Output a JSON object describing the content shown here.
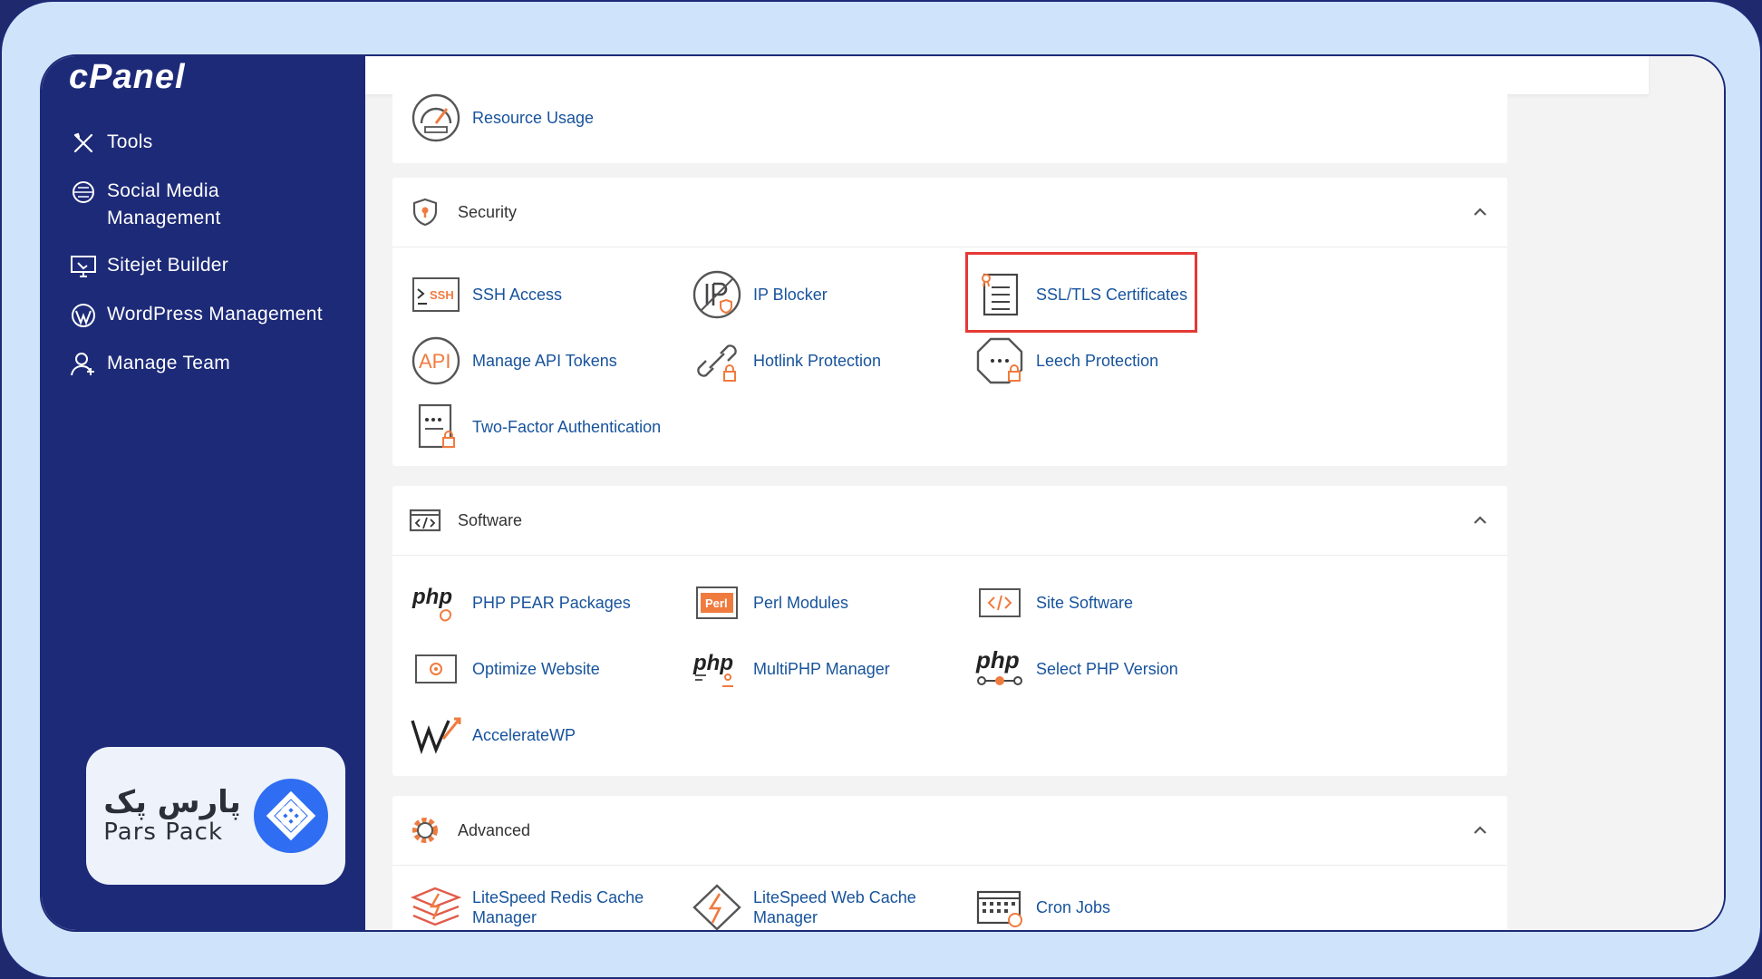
{
  "sidebar": {
    "logo": "cPanel",
    "items": [
      {
        "label": "Tools"
      },
      {
        "label": "Social Media\nManagement"
      },
      {
        "label": "Sitejet Builder"
      },
      {
        "label": "WordPress Management"
      },
      {
        "label": "Manage Team"
      }
    ],
    "brand": {
      "fa": "پارس پک",
      "en": "Pars Pack"
    }
  },
  "resource_usage": {
    "label": "Resource Usage"
  },
  "sections": {
    "security": {
      "title": "Security",
      "items": [
        "SSH Access",
        "IP Blocker",
        "SSL/TLS Certificates",
        "Manage API Tokens",
        "Hotlink Protection",
        "Leech Protection",
        "Two-Factor Authentication"
      ]
    },
    "software": {
      "title": "Software",
      "items": [
        "PHP PEAR Packages",
        "Perl Modules",
        "Site Software",
        "Optimize Website",
        "MultiPHP Manager",
        "Select PHP Version",
        "AccelerateWP"
      ]
    },
    "advanced": {
      "title": "Advanced",
      "items": [
        "LiteSpeed Redis Cache\nManager",
        "LiteSpeed Web Cache\nManager",
        "Cron Jobs"
      ]
    }
  },
  "icons": {
    "perl_badge": "Perl",
    "php_badge": "php",
    "ssh_badge": "SSH",
    "api_badge": "API"
  },
  "colors": {
    "sidebar": "#1d2a78",
    "link": "#17539c",
    "highlight": "#e53935",
    "accent_orange": "#f07b3f"
  }
}
